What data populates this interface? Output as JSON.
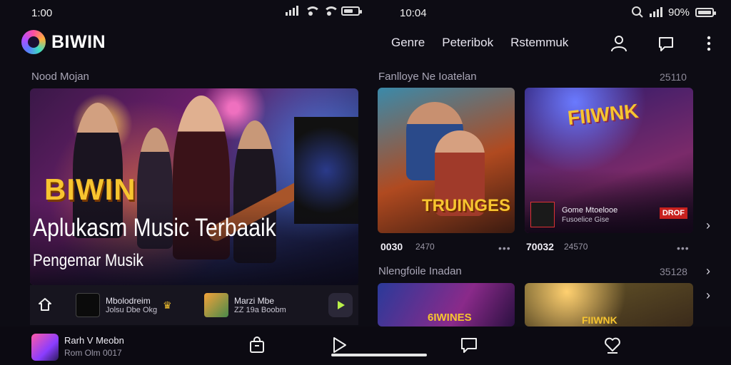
{
  "status_bar": {
    "left_time": "1:00",
    "center_time": "10:04",
    "battery": "90%",
    "battery_fill": 0.9,
    "icons": [
      "signal-icon",
      "wifi-icon",
      "battery-icon",
      "search-icon"
    ]
  },
  "header": {
    "brand": "BIWIN",
    "nav": [
      "Genre",
      "Peteribok",
      "Rstemmuk"
    ],
    "icons": [
      "profile-icon",
      "chat-icon",
      "more-vert-icon"
    ]
  },
  "hero": {
    "section_title": "Nood Mojan",
    "brand_overlay": "BIWIN",
    "title": "Aplukasm Music Terbaaik",
    "subtitle": "Pengemar Musik",
    "strip": [
      {
        "title": "Mbolodreim",
        "subtitle": "Jolsu Dbe Okg"
      },
      {
        "title": "Marzi Mbe",
        "subtitle": "ZZ 19a Boobm"
      }
    ]
  },
  "section1": {
    "title": "Fanlloye Ne Ioatelan",
    "count": "25110",
    "cards": [
      {
        "overlay": "TRUINGES",
        "stat": "0030",
        "stat2": "2470"
      },
      {
        "overlay": "FIIWNK",
        "label": "Gome Mtoelooe",
        "label2": "Fusoelice Gise",
        "tag": "DROF",
        "stat": "70032",
        "stat2": "24570"
      }
    ]
  },
  "section2": {
    "title": "Nlengfoile Inadan",
    "count": "35128",
    "cards": [
      {
        "overlay": "6IWINES"
      },
      {
        "overlay": "FIIWNK"
      }
    ]
  },
  "now_playing": {
    "title": "Rarh V Meobn",
    "subtitle": "Rom Olm 0017"
  },
  "colors": {
    "background": "#0d0c14",
    "accent_yellow": "#f7c530",
    "accent_purple": "#8a3dff",
    "text_primary": "#ffffff",
    "text_muted": "#a9a6b6"
  }
}
